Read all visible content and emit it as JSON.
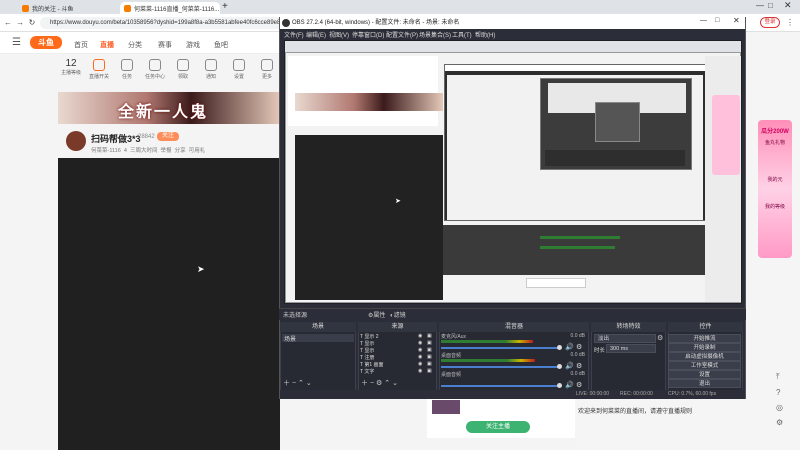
{
  "browser": {
    "tabs": [
      "我的关注 - 斗鱼",
      "何菜菜-1116直播_何菜菜-1116..."
    ],
    "new_tab": "+",
    "url": "https://www.douyu.com/beta/10358956?dyshid=199a8f8a-a3b5581abfee40fc6cce89e8000",
    "profile_label": "登录"
  },
  "douyu": {
    "logo": "斗鱼",
    "nav": [
      "首页",
      "直播",
      "分类",
      "赛事",
      "游戏",
      "鱼吧"
    ],
    "active_nav": "直播",
    "icon_row": [
      {
        "top": "12",
        "label": "主播等级"
      },
      {
        "top": "",
        "label": "直播开关"
      },
      {
        "top": "",
        "label": "任务"
      },
      {
        "top": "",
        "label": "任务中心"
      },
      {
        "top": "",
        "label": "领取"
      },
      {
        "top": "",
        "label": "通知"
      },
      {
        "top": "",
        "label": "设置"
      },
      {
        "top": "",
        "label": "更多"
      }
    ],
    "banner_text": "全新一人鬼",
    "streamer_name": "扫码帮做3*3",
    "streamer_fans": "28842",
    "follow_label": "关注",
    "streamer_meta": [
      "何菜菜-1116",
      "4",
      "三周大时间",
      "举报",
      "分享",
      "可用礼"
    ],
    "chat_line": "欢迎来到何菜菜的直播间，请遵守直播规则",
    "follow_button": "关注主播",
    "ad_texts": [
      "瓜分200W",
      "鱼丸礼物",
      "我的元",
      "我的等级"
    ]
  },
  "obs": {
    "title": "OBS 27.2.4 (64-bit, windows) - 配置文件: 未命名 - 场景: 未命名",
    "menu": [
      "文件(F)",
      "编辑(E)",
      "视图(V)",
      "停靠窗口(D)",
      "配置文件(P)",
      "场景集合(S)",
      "工具(T)",
      "帮助(H)"
    ],
    "no_source": "未选择源",
    "props_label": "属性",
    "filters_label": "滤镜",
    "docks": {
      "scenes": {
        "title": "场景",
        "items": [
          "场景"
        ]
      },
      "sources": {
        "title": "来源",
        "items": [
          "显示 2",
          "显示",
          "显示",
          "注册",
          "第1 画面",
          "文字"
        ]
      },
      "mixer": {
        "title": "混音器",
        "tracks": [
          {
            "name": "麦克风/Aux",
            "db": "0.0 dB",
            "level": 0.8
          },
          {
            "name": "桌面音频",
            "db": "0.0 dB",
            "level": 0.82
          },
          {
            "name": "桌面音频",
            "db": "0.0 dB",
            "level": 0.0
          }
        ],
        "ticks": [
          "-60",
          "-55",
          "-50",
          "-45",
          "-40",
          "-35",
          "-30",
          "-25",
          "-20",
          "-15",
          "-10",
          "-5",
          "0"
        ]
      },
      "transitions": {
        "title": "转场特效",
        "type": "淡出",
        "duration_label": "时长",
        "duration": "300 ms"
      },
      "controls": {
        "title": "控件",
        "buttons": [
          "开始推流",
          "开始录制",
          "启动虚拟摄像机",
          "工作室模式",
          "设置",
          "退出"
        ]
      }
    },
    "status": {
      "live": "LIVE: 00:00:00",
      "rec": "REC: 00:00:00",
      "cpu": "CPU: 0.7%, 60.00 fps"
    }
  }
}
